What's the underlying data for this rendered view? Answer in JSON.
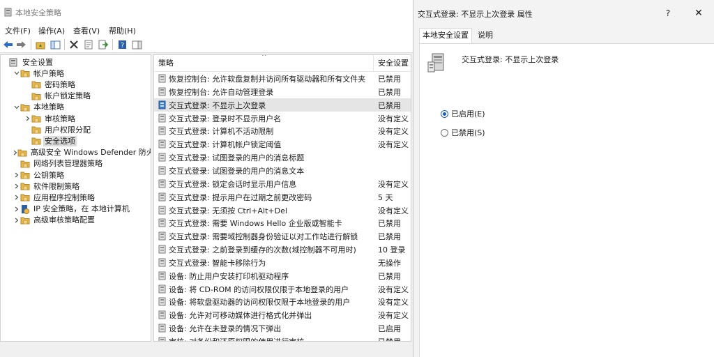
{
  "main_window": {
    "title": "本地安全策略",
    "menu": [
      "文件(F)",
      "操作(A)",
      "查看(V)",
      "帮助(H)"
    ],
    "toolbar_icons": [
      "back-arrow-icon",
      "forward-arrow-icon",
      "up-folder-icon",
      "show-hide-tree-icon",
      "delete-icon",
      "properties-icon",
      "export-list-icon",
      "help-icon",
      "show-hide-action-pane-icon"
    ]
  },
  "tree": {
    "items": [
      {
        "label": "安全设置",
        "indent": 0,
        "toggle": "",
        "icon": "security-settings-icon"
      },
      {
        "label": "帐户策略",
        "indent": 1,
        "toggle": "v",
        "icon": "folder-icon"
      },
      {
        "label": "密码策略",
        "indent": 2,
        "toggle": "",
        "icon": "folder-icon"
      },
      {
        "label": "帐户锁定策略",
        "indent": 2,
        "toggle": "",
        "icon": "folder-icon"
      },
      {
        "label": "本地策略",
        "indent": 1,
        "toggle": "v",
        "icon": "folder-icon"
      },
      {
        "label": "审核策略",
        "indent": 2,
        "toggle": ">",
        "icon": "folder-icon"
      },
      {
        "label": "用户权限分配",
        "indent": 2,
        "toggle": "",
        "icon": "folder-icon"
      },
      {
        "label": "安全选项",
        "indent": 2,
        "toggle": "",
        "icon": "folder-icon",
        "selected": true
      },
      {
        "label": "高级安全 Windows Defender 防火墙",
        "indent": 1,
        "toggle": ">",
        "icon": "folder-icon"
      },
      {
        "label": "网络列表管理器策略",
        "indent": 1,
        "toggle": "",
        "icon": "folder-icon"
      },
      {
        "label": "公钥策略",
        "indent": 1,
        "toggle": ">",
        "icon": "folder-icon"
      },
      {
        "label": "软件限制策略",
        "indent": 1,
        "toggle": ">",
        "icon": "folder-icon"
      },
      {
        "label": "应用程序控制策略",
        "indent": 1,
        "toggle": ">",
        "icon": "folder-icon"
      },
      {
        "label": "IP 安全策略，在 本地计算机",
        "indent": 1,
        "toggle": ">",
        "icon": "ip-security-icon"
      },
      {
        "label": "高级审核策略配置",
        "indent": 1,
        "toggle": ">",
        "icon": "folder-icon"
      }
    ]
  },
  "list": {
    "col_policy": "策略",
    "col_setting": "安全设置",
    "sort_glyph": "^",
    "rows": [
      {
        "name": "恢复控制台: 允许软盘复制并访问所有驱动器和所有文件夹",
        "value": "已禁用"
      },
      {
        "name": "恢复控制台: 允许自动管理登录",
        "value": "已禁用"
      },
      {
        "name": "交互式登录: 不显示上次登录",
        "value": "已禁用",
        "selected": true
      },
      {
        "name": "交互式登录: 登录时不显示用户名",
        "value": "没有定义"
      },
      {
        "name": "交互式登录: 计算机不活动限制",
        "value": "没有定义"
      },
      {
        "name": "交互式登录: 计算机帐户锁定阈值",
        "value": "没有定义"
      },
      {
        "name": "交互式登录: 试图登录的用户的消息标题",
        "value": ""
      },
      {
        "name": "交互式登录: 试图登录的用户的消息文本",
        "value": ""
      },
      {
        "name": "交互式登录: 锁定会话时显示用户信息",
        "value": "没有定义"
      },
      {
        "name": "交互式登录: 提示用户在过期之前更改密码",
        "value": "5 天"
      },
      {
        "name": "交互式登录: 无须按 Ctrl+Alt+Del",
        "value": "没有定义"
      },
      {
        "name": "交互式登录: 需要 Windows Hello 企业版或智能卡",
        "value": "已禁用"
      },
      {
        "name": "交互式登录: 需要域控制器身份验证以对工作站进行解锁",
        "value": "已禁用"
      },
      {
        "name": "交互式登录: 之前登录到缓存的次数(域控制器不可用时)",
        "value": "10 登录"
      },
      {
        "name": "交互式登录: 智能卡移除行为",
        "value": "无操作"
      },
      {
        "name": "设备: 防止用户安装打印机驱动程序",
        "value": "已禁用"
      },
      {
        "name": "设备: 将 CD-ROM 的访问权限仅限于本地登录的用户",
        "value": "没有定义"
      },
      {
        "name": "设备: 将软盘驱动器的访问权限仅限于本地登录的用户",
        "value": "没有定义"
      },
      {
        "name": "设备: 允许对可移动媒体进行格式化并弹出",
        "value": "没有定义"
      },
      {
        "name": "设备: 允许在未登录的情况下弹出",
        "value": "已启用"
      },
      {
        "name": "审核: 对备份和还原权限的使用进行审核",
        "value": "已禁用"
      }
    ]
  },
  "dialog": {
    "title": "交互式登录: 不显示上次登录 属性",
    "help_glyph": "?",
    "close_glyph": "✕",
    "tabs": [
      "本地安全设置",
      "说明"
    ],
    "policy_name": "交互式登录: 不显示上次登录",
    "options": [
      {
        "label": "已启用(E)",
        "checked": true
      },
      {
        "label": "已禁用(S)",
        "checked": false
      }
    ]
  },
  "colors": {
    "accent": "#1f5fbf",
    "folder": "#e8b84a",
    "selected_row": "#e5e5e5"
  }
}
